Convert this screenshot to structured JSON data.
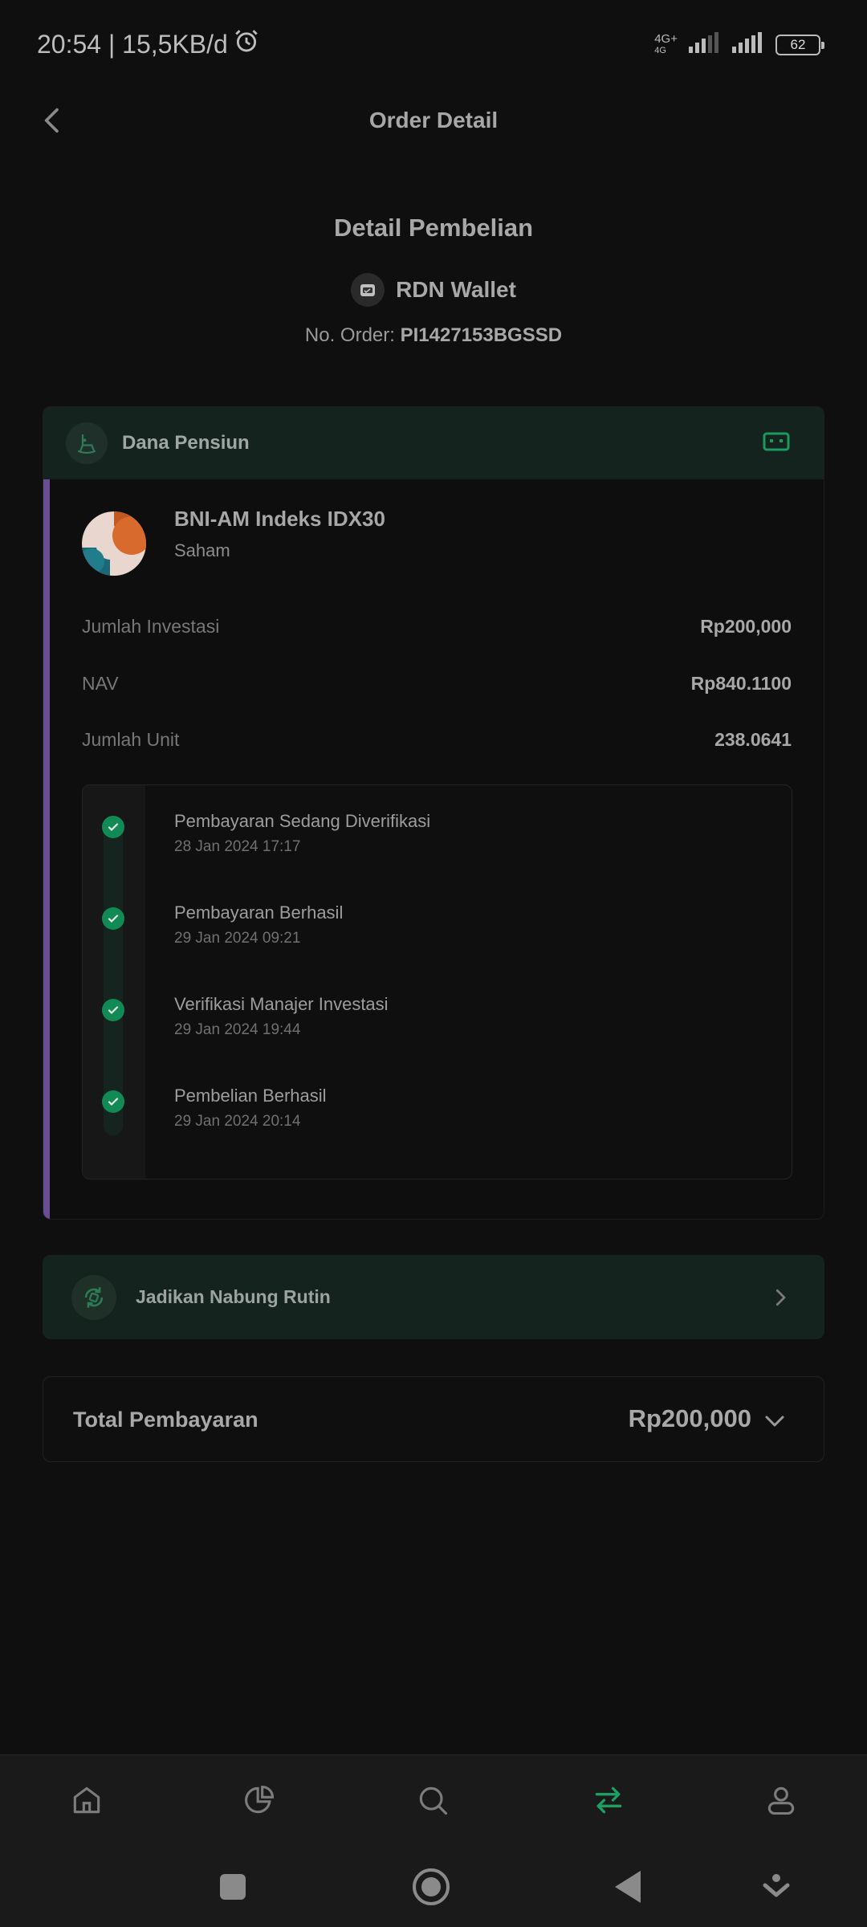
{
  "status_bar": {
    "time_text": "20:54 | 15,5KB/d",
    "network_type_top": "4G+",
    "network_type_bottom": "4G",
    "battery_level": "62"
  },
  "header": {
    "title": "Order Detail"
  },
  "purchase": {
    "section_title": "Detail Pembelian",
    "wallet_label": "RDN Wallet",
    "order_label": "No. Order:",
    "order_number": "PI1427153BGSSD"
  },
  "card": {
    "goal_label": "Dana Pensiun",
    "fund_name": "BNI-AM Indeks IDX30",
    "fund_type": "Saham",
    "rows": [
      {
        "label": "Jumlah Investasi",
        "value": "Rp200,000"
      },
      {
        "label": "NAV",
        "value": "Rp840.1100"
      },
      {
        "label": "Jumlah Unit",
        "value": "238.0641"
      }
    ],
    "timeline": [
      {
        "title": "Pembayaran Sedang Diverifikasi",
        "time": "28 Jan 2024 17:17"
      },
      {
        "title": "Pembayaran Berhasil",
        "time": "29 Jan 2024 09:21"
      },
      {
        "title": "Verifikasi Manajer Investasi",
        "time": "29 Jan 2024 19:44"
      },
      {
        "title": "Pembelian Berhasil",
        "time": "29 Jan 2024 20:14"
      }
    ]
  },
  "nabung": {
    "label": "Jadikan Nabung Rutin"
  },
  "total": {
    "label": "Total Pembayaran",
    "value": "Rp200,000"
  },
  "bottom_nav": {
    "items": [
      "home-icon",
      "portfolio-icon",
      "search-icon",
      "transaction-icon",
      "profile-icon"
    ],
    "active": "transaction-icon",
    "active_color": "#1aa062"
  },
  "colors": {
    "accent_green": "#118a55",
    "card_accent_purple": "#6a4e93"
  }
}
